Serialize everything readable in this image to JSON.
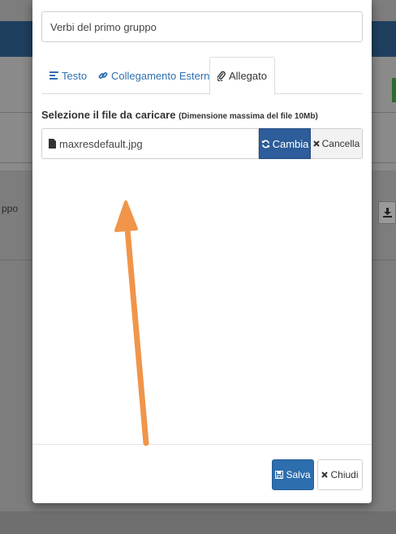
{
  "background": {
    "left_text": "ppo",
    "colors": {
      "header": "#1f3f5f",
      "overlay": "#7d7d7d"
    }
  },
  "modal": {
    "title_value": "Verbi del primo gruppo",
    "tabs": [
      {
        "label": "Testo",
        "icon": "align-left-icon"
      },
      {
        "label": "Collegamento Esterno",
        "icon": "link-icon"
      },
      {
        "label": "Allegato",
        "icon": "paperclip-icon",
        "active": true
      }
    ],
    "file_label": "Selezione il file da caricare",
    "file_hint": "(Dimensione massima del file 10Mb)",
    "file_name": "maxresdefault.jpg",
    "change_label": "Cambia",
    "cancel_label": "Cancella",
    "save_label": "Salva",
    "close_label": "Chiudi"
  },
  "annotation": {
    "arrow_color": "#f0954a"
  }
}
